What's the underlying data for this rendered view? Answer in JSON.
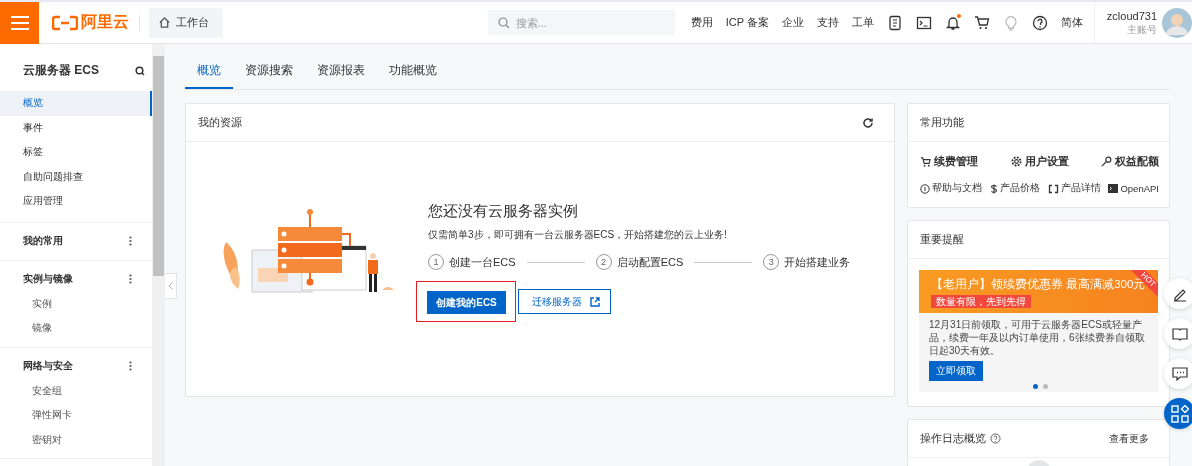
{
  "topbar": {
    "logo_text": "阿里云",
    "workbench": "工作台",
    "search": {
      "placeholder": "搜索..."
    },
    "links": [
      "费用",
      "ICP 备案",
      "企业",
      "支持",
      "工单"
    ],
    "notification": true,
    "language": "简体",
    "user": {
      "name": "zcloud731",
      "role": "主账号"
    }
  },
  "sidebar": {
    "title": "云服务器 ECS",
    "items": [
      {
        "label": "概览",
        "selected": true
      },
      {
        "label": "事件",
        "selected": false
      },
      {
        "label": "标签",
        "selected": false
      },
      {
        "label": "自助问题排查",
        "selected": false
      },
      {
        "label": "应用管理",
        "selected": false
      }
    ],
    "groups": [
      {
        "title": "我的常用"
      },
      {
        "title": "实例与镜像",
        "children": [
          {
            "label": "实例"
          },
          {
            "label": "镜像"
          }
        ]
      },
      {
        "title": "网络与安全",
        "children": [
          {
            "label": "安全组"
          },
          {
            "label": "弹性网卡"
          },
          {
            "label": "密钥对"
          }
        ]
      }
    ]
  },
  "tabs": [
    {
      "label": "概览",
      "selected": true
    },
    {
      "label": "资源搜索",
      "selected": false
    },
    {
      "label": "资源报表",
      "selected": false
    },
    {
      "label": "功能概览",
      "selected": false
    }
  ],
  "resources": {
    "title": "我的资源",
    "heading": "您还没有云服务器实例",
    "description": "仅需简单3步，即可拥有一台云服务器ECS，开始搭建您的云上业务!",
    "steps": [
      {
        "number": "1",
        "label": "创建一台ECS"
      },
      {
        "number": "2",
        "label": "启动配置ECS"
      },
      {
        "number": "3",
        "label": "开始搭建业务"
      }
    ],
    "primary_button": {
      "label": "创建我的ECS",
      "highlighted": true
    },
    "secondary_button": "迁移服务器"
  },
  "common": {
    "title": "常用功能",
    "main_links": [
      {
        "kind": "cart",
        "label": "续费管理"
      },
      {
        "kind": "gear",
        "label": "用户设置"
      },
      {
        "kind": "key",
        "label": "权益配额"
      }
    ],
    "small_links": [
      {
        "kind": "info",
        "label": "帮助与文档"
      },
      {
        "kind": "dollar",
        "label": "产品价格"
      },
      {
        "kind": "brackets",
        "label": "产品详情"
      },
      {
        "kind": "terminal",
        "label": "OpenAPI"
      }
    ]
  },
  "reminder": {
    "title": "重要提醒",
    "promo_title": "【老用户】领续费优惠券 最高满减300元",
    "tag": "数量有限，先到先得",
    "ribbon": "HOT",
    "body": "12月31日前领取，可用于云服务器ECS或轻量产品，续费一年及以内订单使用，6张续费券自领取日起30天有效。",
    "button": "立即领取",
    "dots": [
      {
        "selected": true
      },
      {
        "selected": false
      }
    ]
  },
  "log": {
    "title": "操作日志概览",
    "more": "查看更多"
  }
}
